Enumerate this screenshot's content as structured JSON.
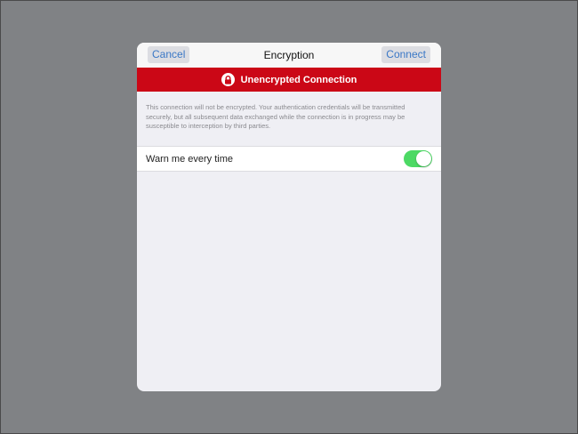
{
  "navbar": {
    "cancel_label": "Cancel",
    "title": "Encryption",
    "connect_label": "Connect"
  },
  "banner": {
    "icon": "lock-icon",
    "text": "Unencrypted Connection",
    "color": "#cb0716"
  },
  "description": "This connection will not be encrypted. Your authentication credentials will be transmitted securely, but all subsequent data exchanged while the connection is in progress may be susceptible to interception by third parties.",
  "settings": {
    "warn_label": "Warn me every time",
    "warn_enabled": true,
    "toggle_color": "#4cd964"
  },
  "colors": {
    "accent": "#3b78c6",
    "backdrop": "#808285",
    "panel": "#efeff4"
  }
}
